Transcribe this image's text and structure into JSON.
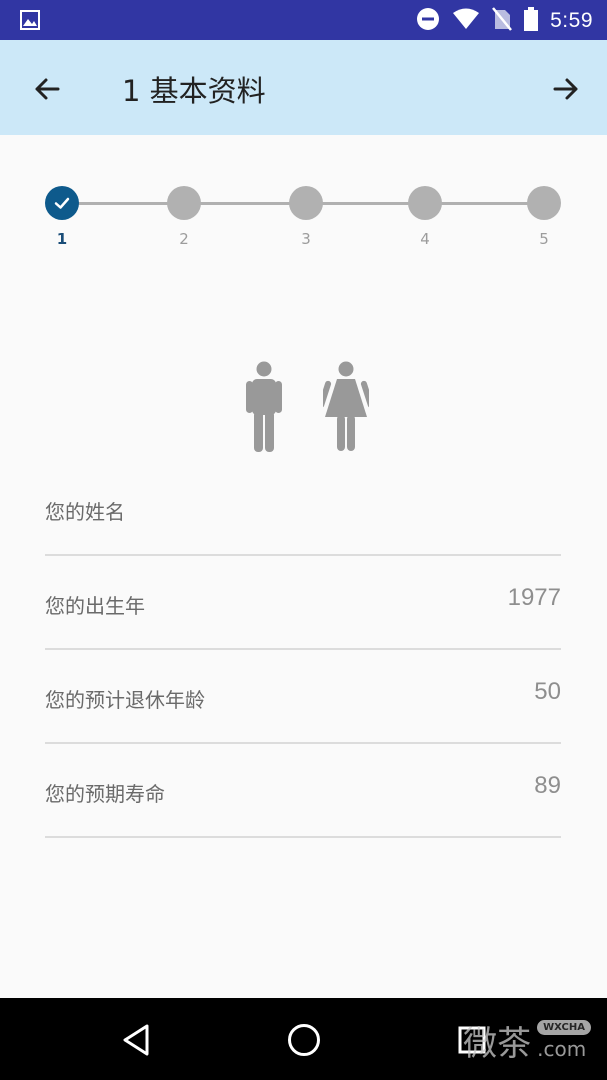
{
  "status_bar": {
    "time": "5:59",
    "icons": [
      "image-icon",
      "dnd-icon",
      "wifi-icon",
      "no-sim-icon",
      "battery-icon"
    ]
  },
  "app_bar": {
    "title": "1 基本资料",
    "back_icon": "arrow-left-icon",
    "forward_icon": "arrow-right-icon"
  },
  "stepper": {
    "steps": [
      {
        "label": "1",
        "state": "completed"
      },
      {
        "label": "2",
        "state": "pending"
      },
      {
        "label": "3",
        "state": "pending"
      },
      {
        "label": "4",
        "state": "pending"
      },
      {
        "label": "5",
        "state": "pending"
      }
    ]
  },
  "gender": {
    "options": [
      {
        "icon": "male-icon"
      },
      {
        "icon": "female-icon"
      }
    ]
  },
  "form": {
    "name": {
      "label": "您的姓名",
      "value": ""
    },
    "birth_year": {
      "label": "您的出生年",
      "value": "1977"
    },
    "retire_age": {
      "label": "您的预计退休年龄",
      "value": "50"
    },
    "life_expectancy": {
      "label": "您的预期寿命",
      "value": "89"
    }
  },
  "nav_bar": {
    "buttons": [
      "back-triangle-icon",
      "home-circle-icon",
      "recents-square-icon"
    ]
  },
  "watermark": {
    "text": "微茶",
    "tag": "WXCHA",
    "domain": ".com"
  },
  "colors": {
    "status_bar": "#3136a3",
    "app_bar": "#cce8f8",
    "step_active": "#0e5a8c",
    "step_inactive": "#b1b1b1"
  }
}
